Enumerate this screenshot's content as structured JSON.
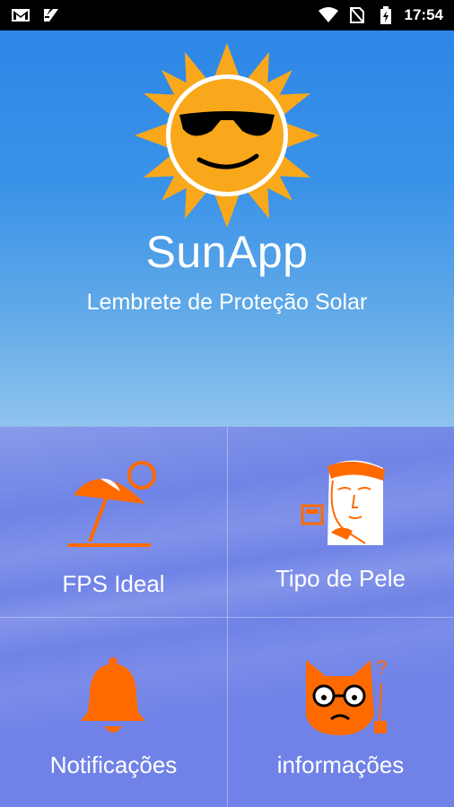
{
  "status_bar": {
    "time": "17:54",
    "icons": [
      "gmail-icon",
      "notification-icon",
      "wifi-icon",
      "no-sim-icon",
      "battery-charging-icon"
    ]
  },
  "header": {
    "title": "SunApp",
    "subtitle": "Lembrete de Proteção Solar",
    "logo_icon": "sun-with-sunglasses-icon"
  },
  "menu": {
    "items": [
      {
        "label": "FPS Ideal",
        "icon": "beach-umbrella-icon"
      },
      {
        "label": "Tipo de Pele",
        "icon": "woman-face-icon"
      },
      {
        "label": "Notificações",
        "icon": "bell-icon"
      },
      {
        "label": "informações",
        "icon": "cat-glasses-icon"
      }
    ]
  },
  "colors": {
    "accent_orange": "#ff6a00",
    "sun_yellow": "#f9a81c",
    "sky_blue": "#2d86e6",
    "grid_overlay": "#7882e6"
  }
}
